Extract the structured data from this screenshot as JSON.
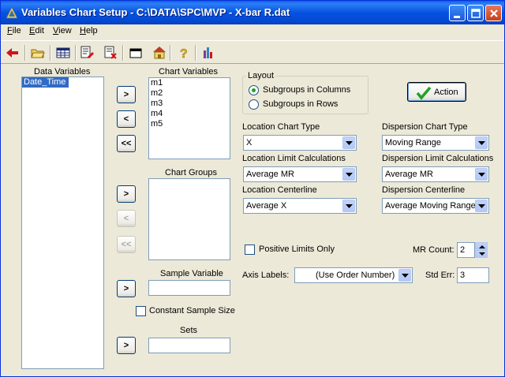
{
  "window": {
    "title": "Variables Chart Setup - C:\\DATA\\SPC\\MVP - X-bar R.dat"
  },
  "menu": [
    "File",
    "Edit",
    "View",
    "Help"
  ],
  "toolbar": [
    "back-arrow",
    "open-folder",
    "table",
    "edit-data",
    "delete",
    "window",
    "home",
    "help",
    "chart-bars"
  ],
  "data_variables": {
    "label": "Data Variables",
    "items": [
      "Date_Time"
    ]
  },
  "chart_variables": {
    "label": "Chart Variables",
    "items": [
      "m1",
      "m2",
      "m3",
      "m4",
      "m5"
    ]
  },
  "chart_groups": {
    "label": "Chart Groups"
  },
  "sample_variable": {
    "label": "Sample Variable",
    "value": ""
  },
  "constant_sample_size": {
    "label": "Constant Sample Size",
    "checked": false
  },
  "sets": {
    "label": "Sets",
    "value": ""
  },
  "transfer_buttons": {
    "add": ">",
    "remove": "<",
    "remove_all": "<<"
  },
  "layout": {
    "label": "Layout",
    "options": [
      "Subgroups in Columns",
      "Subgroups in Rows"
    ],
    "selected": "Subgroups in Columns"
  },
  "action_button": {
    "label": "Action"
  },
  "location_chart_type": {
    "label": "Location Chart Type",
    "value": "X"
  },
  "dispersion_chart_type": {
    "label": "Dispersion Chart Type",
    "value": "Moving Range"
  },
  "location_limit": {
    "label": "Location Limit Calculations",
    "value": "Average MR"
  },
  "dispersion_limit": {
    "label": "Dispersion Limit Calculations",
    "value": "Average MR"
  },
  "location_centerline": {
    "label": "Location Centerline",
    "value": "Average X"
  },
  "dispersion_centerline": {
    "label": "Dispersion Centerline",
    "value": "Average Moving Range"
  },
  "positive_limits": {
    "label": "Positive Limits Only",
    "checked": false
  },
  "mr_count": {
    "label": "MR Count:",
    "value": "2"
  },
  "axis_labels": {
    "label": "Axis Labels:",
    "value": "(Use Order Number)"
  },
  "std_err": {
    "label": "Std Err:",
    "value": "3"
  },
  "colors": {
    "titlebar": "#0553e1",
    "selection": "#316ac5",
    "face": "#ece9d8",
    "check_green": "#21a121"
  }
}
